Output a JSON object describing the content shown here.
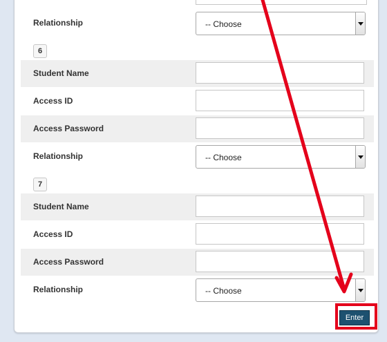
{
  "form": {
    "top_relationship": {
      "label": "Relationship",
      "select_value": "-- Choose"
    },
    "students": [
      {
        "number": "6",
        "student_name_label": "Student Name",
        "access_id_label": "Access ID",
        "access_password_label": "Access Password",
        "relationship_label": "Relationship",
        "relationship_value": "-- Choose"
      },
      {
        "number": "7",
        "student_name_label": "Student Name",
        "access_id_label": "Access ID",
        "access_password_label": "Access Password",
        "relationship_label": "Relationship",
        "relationship_value": "-- Choose"
      }
    ],
    "enter_label": "Enter"
  },
  "annotation": {
    "color": "#e4001b"
  }
}
